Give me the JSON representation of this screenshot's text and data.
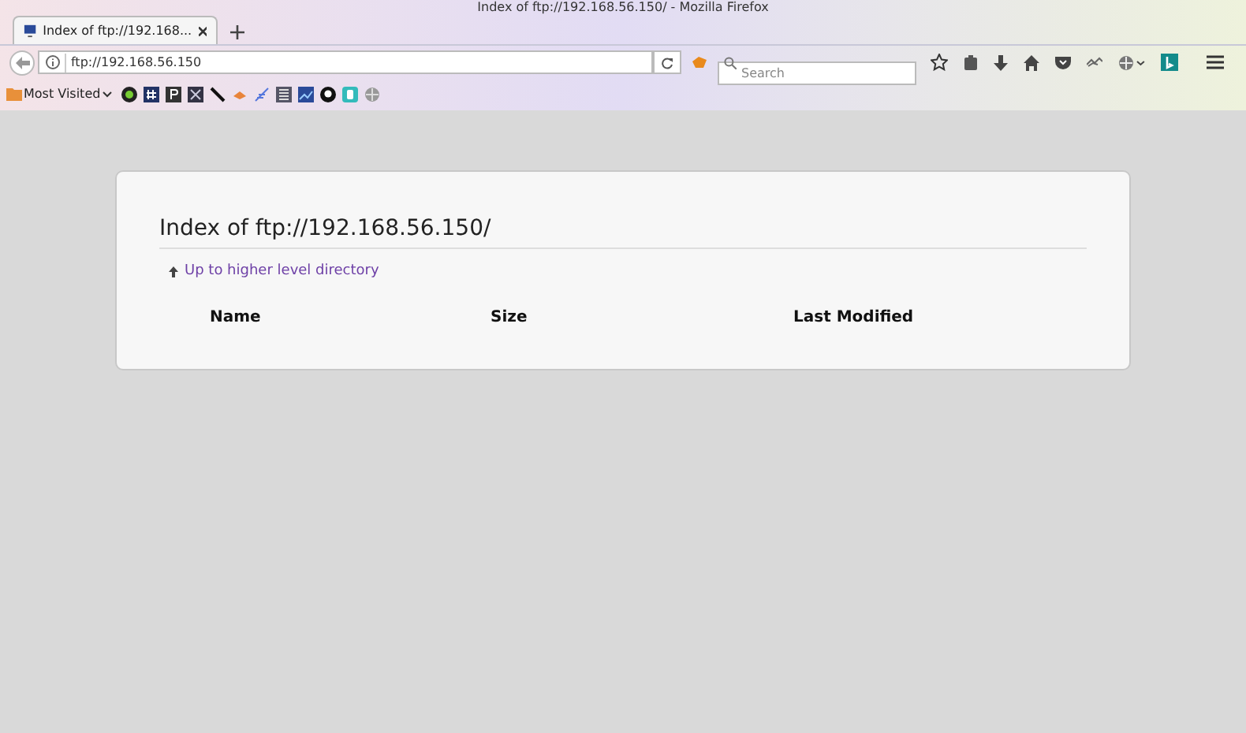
{
  "window": {
    "title": "Index of ftp://192.168.56.150/ - Mozilla Firefox"
  },
  "tabs": [
    {
      "title": "Index of ftp://192.168...",
      "selected": true
    }
  ],
  "url_bar": {
    "value": "ftp://192.168.56.150"
  },
  "search": {
    "placeholder": "Search"
  },
  "bookmarks_toolbar": {
    "folder": "Most Visited"
  },
  "page": {
    "heading": "Index of ftp://192.168.56.150/",
    "parent_link": "Up to higher level directory",
    "columns": [
      "Name",
      "Size",
      "Last Modified"
    ]
  }
}
